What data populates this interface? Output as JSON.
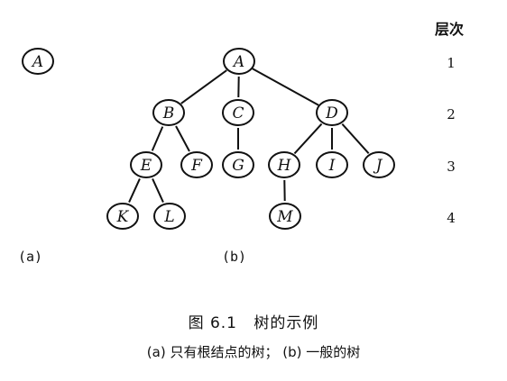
{
  "level_header": "层次",
  "levels": [
    "1",
    "2",
    "3",
    "4"
  ],
  "subfigure_labels": [
    "(a)",
    "(b)"
  ],
  "tree_a": {
    "nodes": [
      {
        "id": "A",
        "level": 1
      }
    ]
  },
  "tree_b": {
    "nodes": [
      {
        "id": "A",
        "level": 1
      },
      {
        "id": "B",
        "level": 2,
        "parent": "A"
      },
      {
        "id": "C",
        "level": 2,
        "parent": "A"
      },
      {
        "id": "D",
        "level": 2,
        "parent": "A"
      },
      {
        "id": "E",
        "level": 3,
        "parent": "B"
      },
      {
        "id": "F",
        "level": 3,
        "parent": "B"
      },
      {
        "id": "G",
        "level": 3,
        "parent": "C"
      },
      {
        "id": "H",
        "level": 3,
        "parent": "D"
      },
      {
        "id": "I",
        "level": 3,
        "parent": "D"
      },
      {
        "id": "J",
        "level": 3,
        "parent": "D"
      },
      {
        "id": "K",
        "level": 4,
        "parent": "E"
      },
      {
        "id": "L",
        "level": 4,
        "parent": "E"
      },
      {
        "id": "M",
        "level": 4,
        "parent": "H"
      }
    ]
  },
  "figure": {
    "number": "图 6.1",
    "title": "树的示例",
    "caption": "(a) 只有根结点的树； (b) 一般的树"
  }
}
